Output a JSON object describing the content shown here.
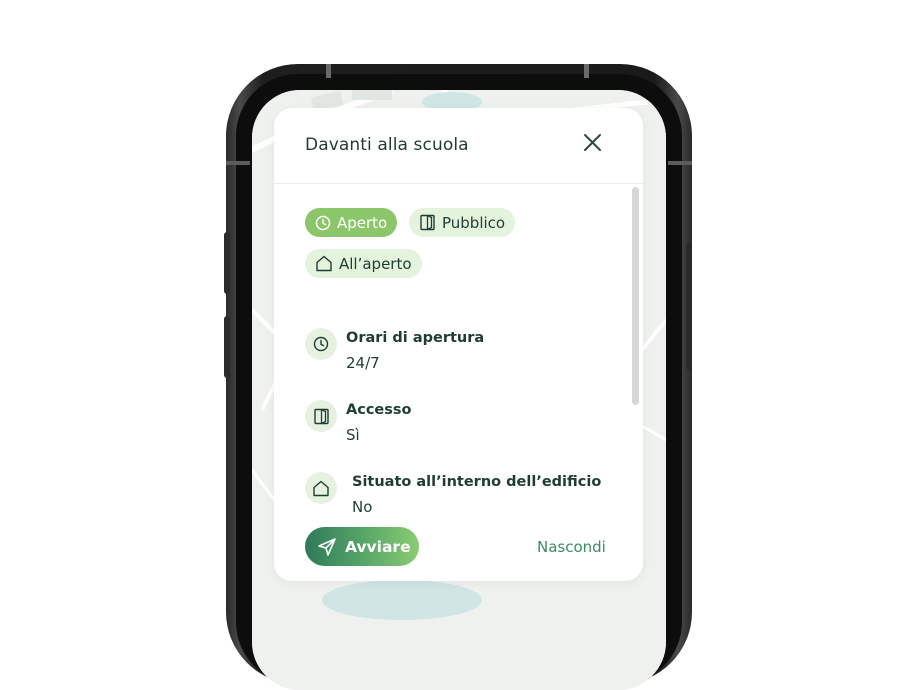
{
  "card": {
    "title": "Davanti alla scuola",
    "close_icon": "close-icon"
  },
  "chips": [
    {
      "label": "Aperto",
      "icon": "clock-icon",
      "active": true
    },
    {
      "label": "Pubblico",
      "icon": "door-icon",
      "active": false
    },
    {
      "label": "All’aperto",
      "icon": "house-icon",
      "active": false
    }
  ],
  "details": [
    {
      "label": "Orari di apertura",
      "value": "24/7",
      "icon": "clock-icon"
    },
    {
      "label": "Accesso",
      "value": "Sì",
      "icon": "door-icon"
    },
    {
      "label": "Situato all’interno dell’edificio",
      "value": "No",
      "icon": "house-icon"
    }
  ],
  "footer": {
    "primary_label": "Avviare",
    "primary_icon": "navigation-arrow-icon",
    "secondary_label": "Nascondi"
  },
  "colors": {
    "accent": "#8cc66a",
    "chip_bg": "#e4f3dc",
    "text_dark": "#1f3d35",
    "link": "#3e8a63"
  }
}
